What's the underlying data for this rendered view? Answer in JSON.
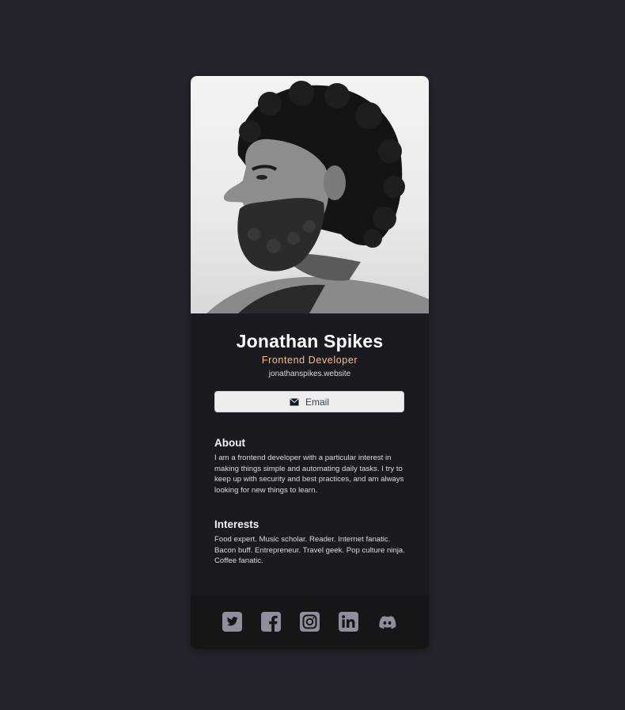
{
  "profile": {
    "name": "Jonathan Spikes",
    "role": "Frontend Developer",
    "website": "jonathanspikes.website",
    "email_button_label": "Email",
    "email_icon": "envelope-icon",
    "photo_alt": "Jonathan Spikes"
  },
  "about": {
    "heading": "About",
    "text": "I am a frontend developer with a particular interest in making things simple and automating daily tasks. I try to keep up with security and best practices, and am always looking for new things to learn."
  },
  "interests": {
    "heading": "Interests",
    "text": "Food expert. Music scholar. Reader. Internet fanatic. Bacon buff. Entrepreneur. Travel geek. Pop culture ninja. Coffee fanatic."
  },
  "social": [
    {
      "name": "twitter-icon"
    },
    {
      "name": "facebook-icon"
    },
    {
      "name": "instagram-icon"
    },
    {
      "name": "linkedin-icon"
    },
    {
      "name": "discord-icon"
    }
  ],
  "colors": {
    "page_background": "#23252c",
    "card_background": "#1a1b21",
    "footer_background": "#161619",
    "accent": "#f3bf99",
    "icon": "#918e9b"
  }
}
